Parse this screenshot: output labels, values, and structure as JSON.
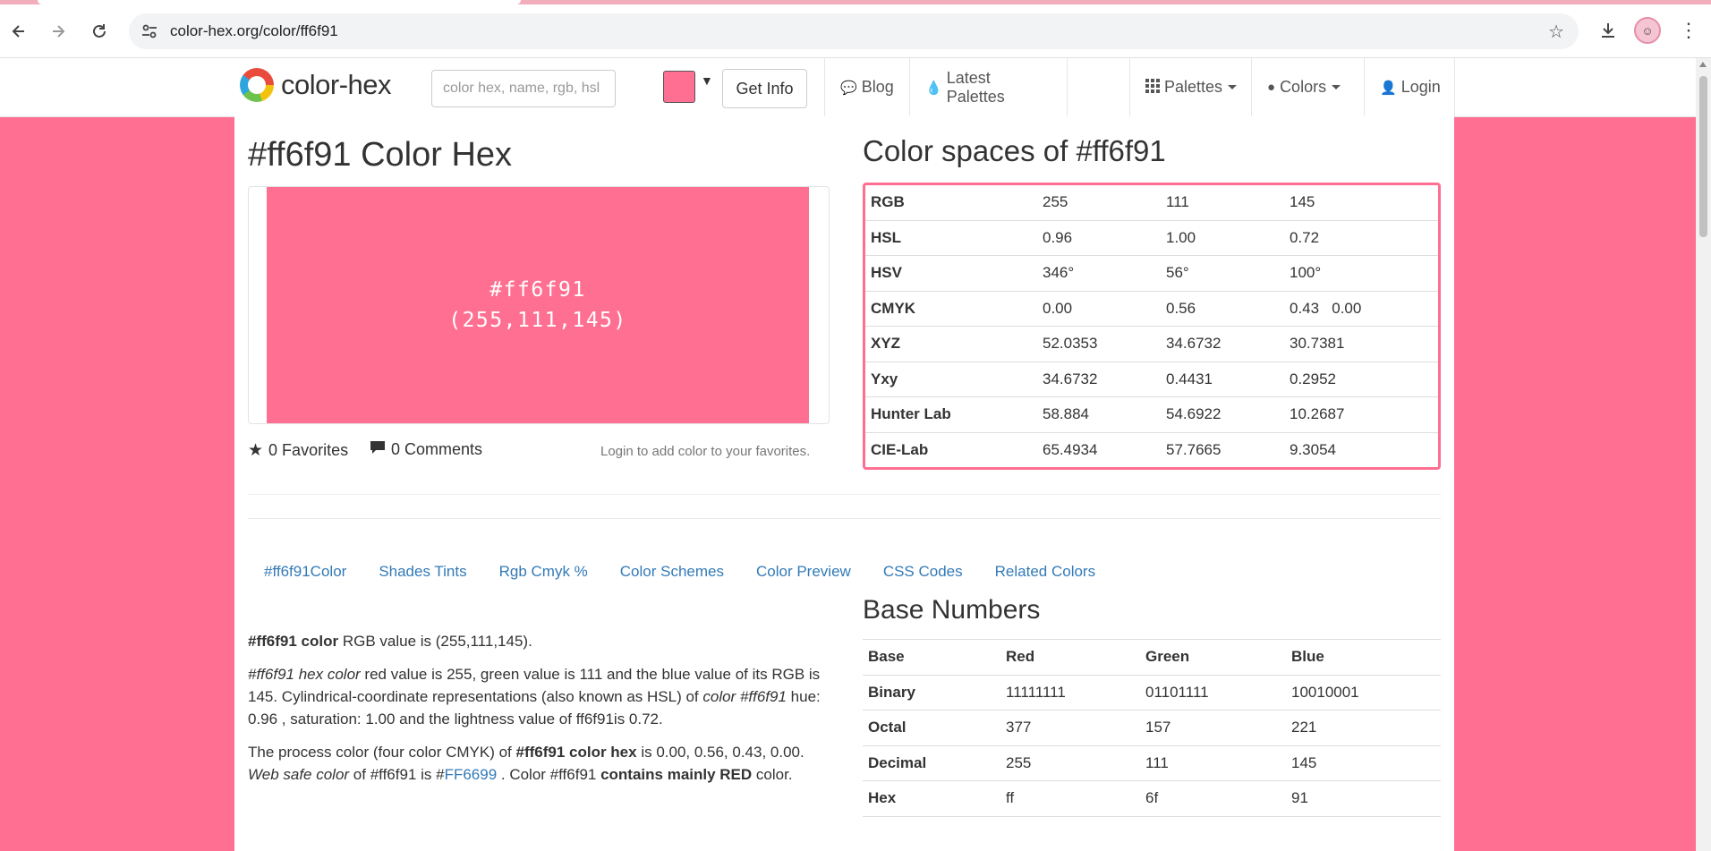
{
  "browser": {
    "url": "color-hex.org/color/ff6f91"
  },
  "site": {
    "logo_text": "color-hex",
    "search_placeholder": "color hex, name, rgb, hsl or",
    "get_info_label": "Get Info",
    "nav": {
      "blog": "Blog",
      "latest_palettes": "Latest Palettes",
      "palettes": "Palettes",
      "colors": "Colors",
      "login": "Login"
    }
  },
  "colors": {
    "swatch": "#ff6f91",
    "link": "#337ab7",
    "border_accent": "#ff6f91"
  },
  "main": {
    "title": "#ff6f91 Color Hex",
    "preview_hex": "#ff6f91",
    "preview_rgb": "(255,111,145)",
    "favorites": "0 Favorites",
    "comments": "0 Comments",
    "login_note": "Login to add color to your favorites."
  },
  "color_spaces": {
    "title": "Color spaces of #ff6f91",
    "rows": [
      {
        "name": "RGB",
        "v1": "255",
        "v2": "111",
        "v3": "145"
      },
      {
        "name": "HSL",
        "v1": "0.96",
        "v2": "1.00",
        "v3": "0.72"
      },
      {
        "name": "HSV",
        "v1": "346°",
        "v2": "56°",
        "v3": "100°"
      },
      {
        "name": "CMYK",
        "v1": "0.00",
        "v2": "0.56",
        "v3": "0.43   0.00"
      },
      {
        "name": "XYZ",
        "v1": "52.0353",
        "v2": "34.6732",
        "v3": "30.7381"
      },
      {
        "name": "Yxy",
        "v1": "34.6732",
        "v2": "0.4431",
        "v3": "0.2952"
      },
      {
        "name": "Hunter Lab",
        "v1": "58.884",
        "v2": "54.6922",
        "v3": "10.2687"
      },
      {
        "name": "CIE-Lab",
        "v1": "65.4934",
        "v2": "57.7665",
        "v3": "9.3054"
      }
    ]
  },
  "tabs": [
    "#ff6f91Color",
    "Shades Tints",
    "Rgb Cmyk %",
    "Color Schemes",
    "Color Preview",
    "CSS Codes",
    "Related Colors"
  ],
  "description": {
    "p1_bold": "#ff6f91 color",
    "p1_rest": " RGB value is (255,111,145).",
    "p2_italic": "#ff6f91 hex color",
    "p2_a": " red value is 255, green value is 111 and the blue value of its RGB is 145. Cylindrical-coordinate representations (also known as HSL) of ",
    "p2_italic2": "color #ff6f91",
    "p2_b": " hue: 0.96 , saturation: 1.00 and the lightness value of ff6f91is 0.72.",
    "p3_a": "The process color (four color CMYK) of ",
    "p3_bold": "#ff6f91 color hex",
    "p3_b": " is 0.00, 0.56, 0.43, 0.00. ",
    "p3_italic": "Web safe color",
    "p3_c": " of #ff6f91 is #",
    "p3_link": "FF6699",
    "p3_d": " . Color #ff6f91 ",
    "p3_bold2": "contains mainly RED",
    "p3_e": " color."
  },
  "base_numbers": {
    "title": "Base Numbers",
    "header": [
      "Base",
      "Red",
      "Green",
      "Blue"
    ],
    "rows": [
      [
        "Binary",
        "11111111",
        "01101111",
        "10010001"
      ],
      [
        "Octal",
        "377",
        "157",
        "221"
      ],
      [
        "Decimal",
        "255",
        "111",
        "145"
      ],
      [
        "Hex",
        "ff",
        "6f",
        "91"
      ]
    ]
  }
}
